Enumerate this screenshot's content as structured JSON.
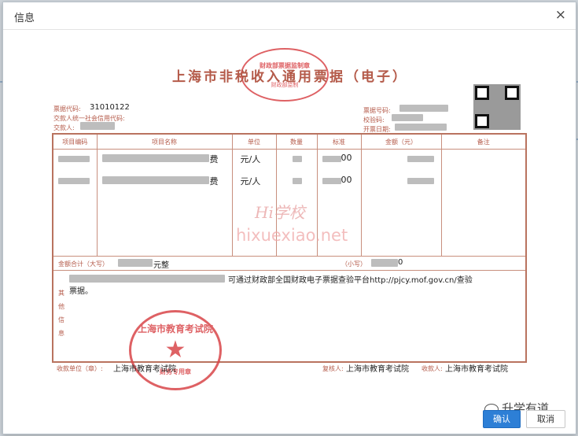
{
  "dialog": {
    "title": "信息",
    "close_symbol": "×"
  },
  "receipt": {
    "title": "上海市非税收入通用票据（电子）",
    "top_seal": {
      "line1": "财政部票据监制章",
      "line2": "财政部监制"
    },
    "labels": {
      "code": "票据代码:",
      "payer_credit": "交款人统一社会信用代码:",
      "payer": "交款人:",
      "number": "票据号码:",
      "check_code": "校验码:",
      "issue_date": "开票日期:"
    },
    "code_value": "31010122",
    "table": {
      "headers": [
        "项目编码",
        "项目名称",
        "单位",
        "数量",
        "标准",
        "金额（元）",
        "备注"
      ],
      "rows": [
        {
          "name_suffix": "费",
          "unit": "元/人",
          "standard_suffix": "00"
        },
        {
          "name_suffix": "费",
          "unit": "元/人",
          "standard_suffix": "00"
        }
      ],
      "total_label": "金额合计（大写）",
      "total_upper_suffix": "元整",
      "total_small_label": "（小写）",
      "total_small_suffix": "0",
      "note_text": "可通过财政部全国财政电子票据查验平台http://pjcy.mof.gov.cn/查验",
      "note_text2": "票据。",
      "side_label": [
        "其",
        "他",
        "信",
        "息"
      ]
    },
    "footer": {
      "payee_label": "收款单位（章）:",
      "payee_value": "上海市教育考试院",
      "reviewer_label": "复核人:",
      "reviewer_value": "上海市教育考试院",
      "collector_label": "收款人:",
      "collector_value": "上海市教育考试院"
    },
    "bottom_seal": {
      "top": "上海市教育考试院",
      "star": "★",
      "bottom": "财务专用章"
    }
  },
  "watermark": {
    "line1": "Hi学校",
    "line2": "hixuexiao.net"
  },
  "buttons": {
    "ok": "确认",
    "cancel": "取消"
  },
  "brand": {
    "text": "升学有道"
  }
}
